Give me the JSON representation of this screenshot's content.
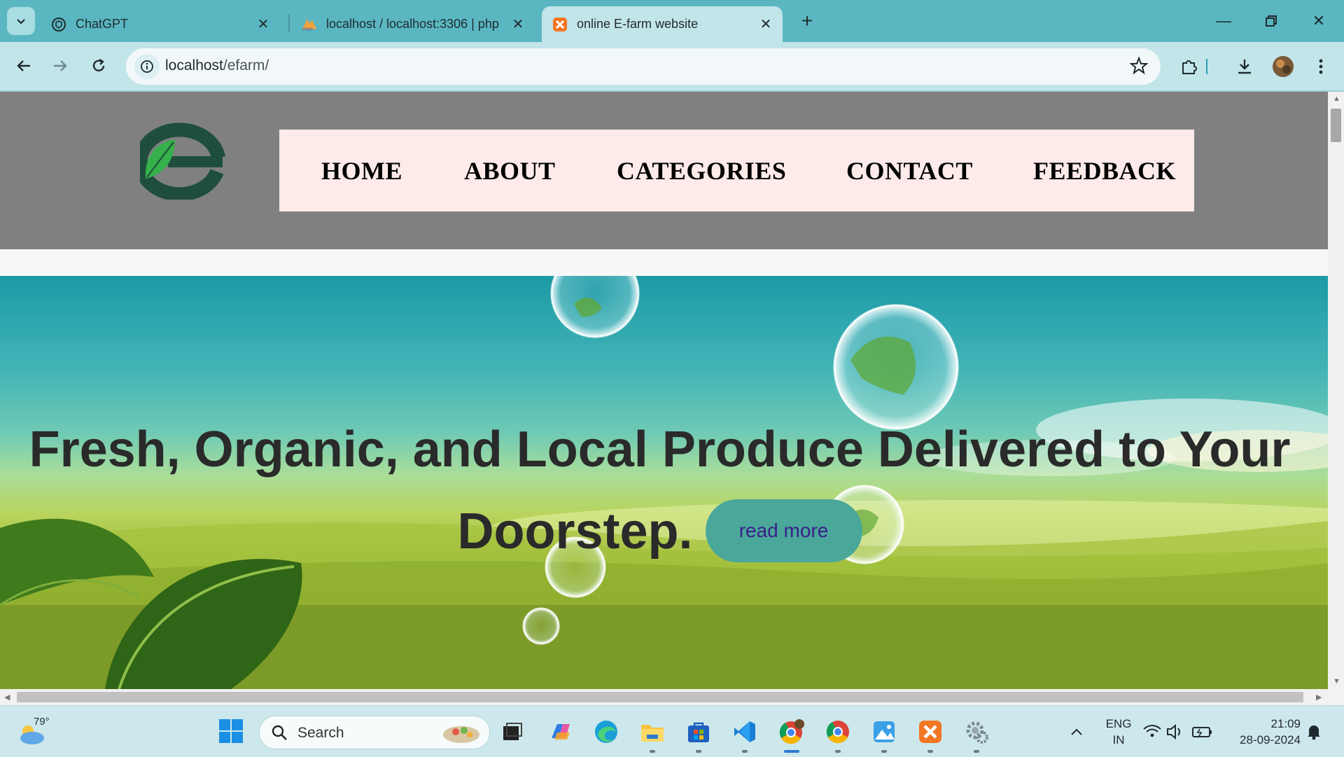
{
  "browser": {
    "tabs": [
      {
        "title": "ChatGPT",
        "active": false,
        "icon": "chatgpt-icon"
      },
      {
        "title": "localhost / localhost:3306 | php",
        "active": false,
        "icon": "phpmyadmin-icon"
      },
      {
        "title": "online E-farm website",
        "active": true,
        "icon": "xampp-icon"
      }
    ],
    "url_host": "localhost",
    "url_path": "/efarm/"
  },
  "site": {
    "nav": [
      {
        "label": "HOME"
      },
      {
        "label": "ABOUT"
      },
      {
        "label": "CATEGORIES"
      },
      {
        "label": "CONTACT"
      },
      {
        "label": "FEEDBACK"
      }
    ],
    "hero": {
      "title": "Fresh, Organic, and Local Produce Delivered to Your Doorstep.",
      "button": "read more"
    }
  },
  "taskbar": {
    "weather_temp": "79°",
    "search_placeholder": "Search",
    "apps": [
      "task-view",
      "copilot",
      "edge",
      "file-explorer",
      "microsoft-store",
      "vscode",
      "chrome-profile",
      "chrome",
      "photos",
      "xampp",
      "settings"
    ],
    "lang_top": "ENG",
    "lang_bottom": "IN",
    "time": "21:09",
    "date": "28-09-2024"
  },
  "colors": {
    "tabbar": "#5ab7c1",
    "toolbar": "#c2e5ea",
    "header": "#808080",
    "nav_bg": "#ffeaea",
    "button": "#4aa79a"
  }
}
